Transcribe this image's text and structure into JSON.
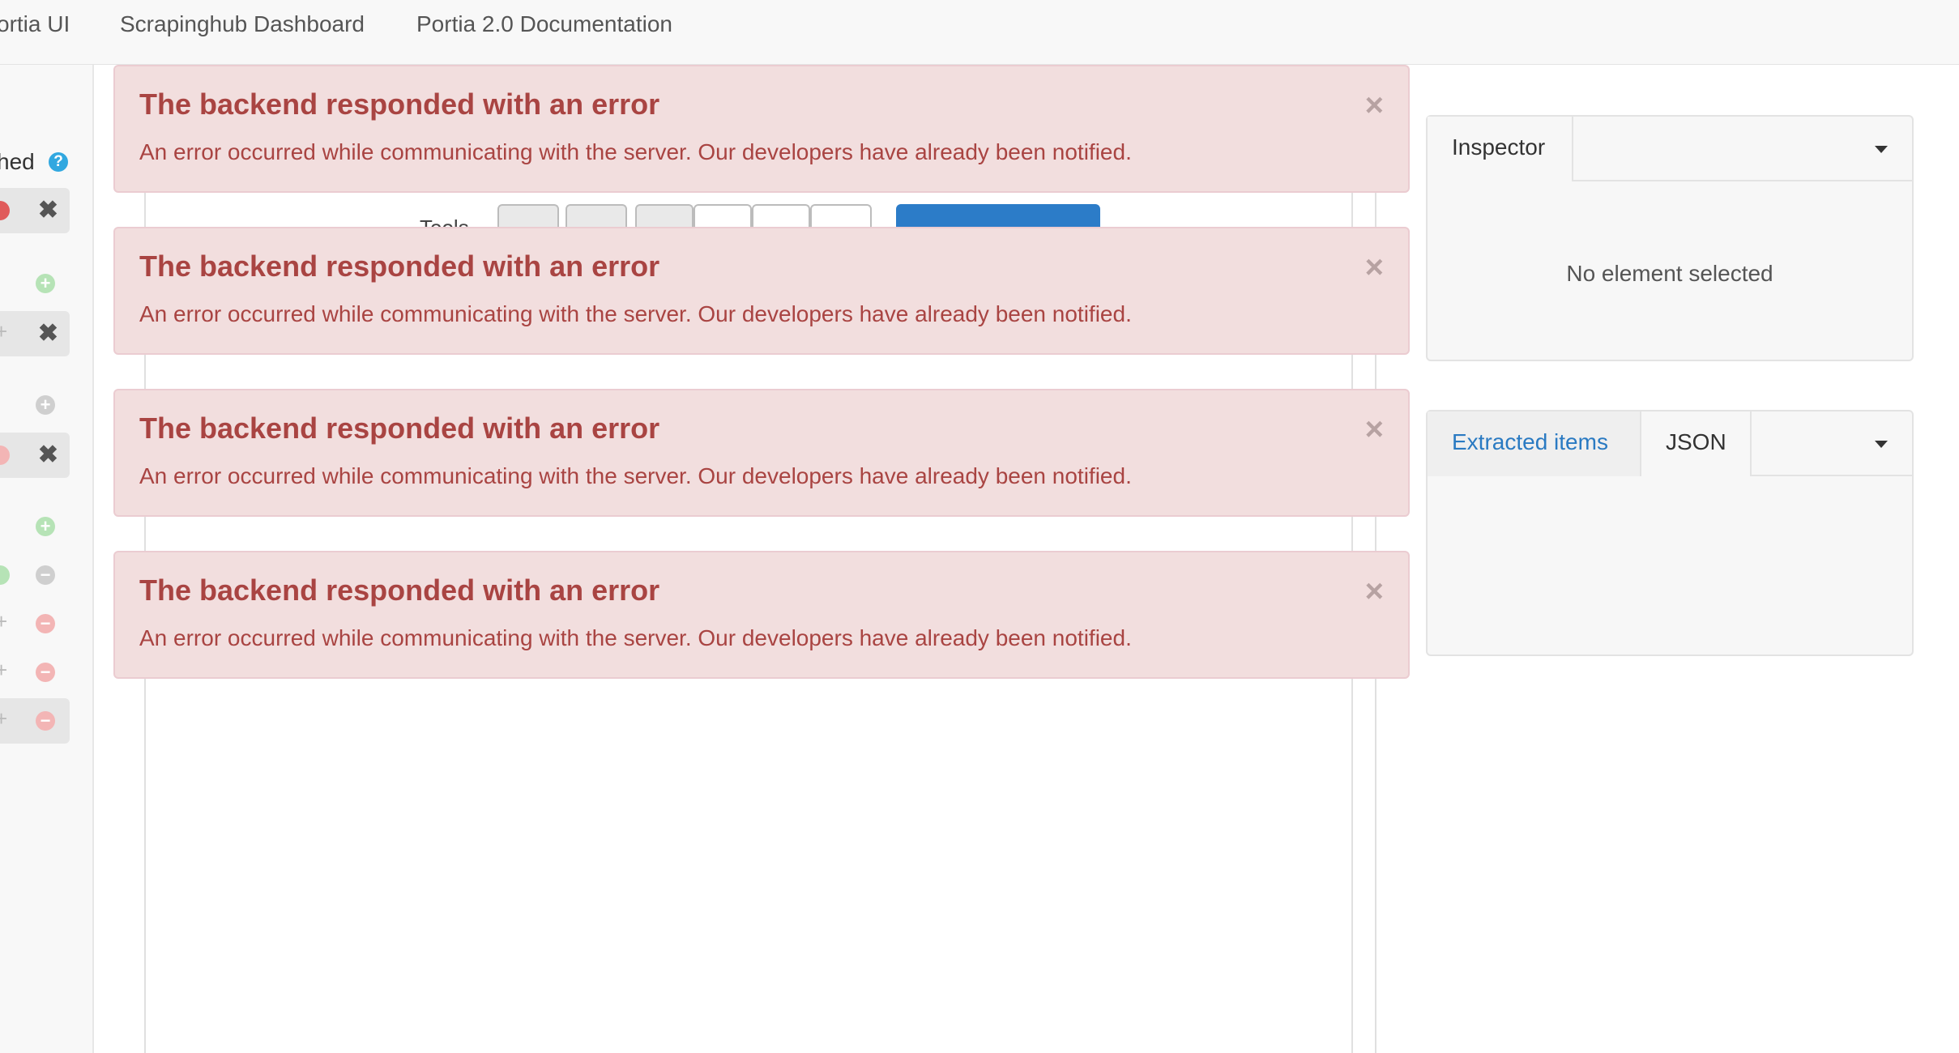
{
  "nav": {
    "links": [
      "ortia UI",
      "Scrapinghub Dashboard",
      "Portia 2.0 Documentation"
    ]
  },
  "sidebar": {
    "status_text": "hed",
    "help_icon": "?"
  },
  "toolbar": {
    "label": "Tools"
  },
  "alerts": [
    {
      "title": "The backend responded with an error",
      "message": "An error occurred while communicating with the server. Our developers have already been notified.",
      "close": "×"
    },
    {
      "title": "The backend responded with an error",
      "message": "An error occurred while communicating with the server. Our developers have already been notified.",
      "close": "×"
    },
    {
      "title": "The backend responded with an error",
      "message": "An error occurred while communicating with the server. Our developers have already been notified.",
      "close": "×"
    },
    {
      "title": "The backend responded with an error",
      "message": "An error occurred while communicating with the server. Our developers have already been notified.",
      "close": "×"
    }
  ],
  "inspector": {
    "tab": "Inspector",
    "empty": "No element selected"
  },
  "items_panel": {
    "tab_extracted": "Extracted items",
    "tab_json": "JSON"
  },
  "colors": {
    "alert_bg": "#f2dede",
    "alert_text": "#a94442",
    "link": "#2a7ac2",
    "primary_button": "#2c7cc8"
  }
}
